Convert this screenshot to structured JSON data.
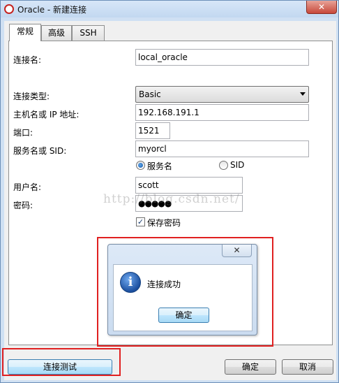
{
  "window": {
    "title": "Oracle - 新建连接",
    "close_glyph": "✕"
  },
  "tabs": [
    {
      "label": "常规"
    },
    {
      "label": "高级"
    },
    {
      "label": "SSH"
    }
  ],
  "form": {
    "connection_name": {
      "label": "连接名:",
      "value": "local_oracle"
    },
    "connection_type": {
      "label": "连接类型:",
      "value": "Basic"
    },
    "host": {
      "label": "主机名或 IP 地址:",
      "value": "192.168.191.1"
    },
    "port": {
      "label": "端口:",
      "value": "1521"
    },
    "service": {
      "label": "服务名或 SID:",
      "value": "myorcl"
    },
    "service_radio": {
      "label": "服务名",
      "selected": true
    },
    "sid_radio": {
      "label": "SID",
      "selected": false
    },
    "username": {
      "label": "用户名:",
      "value": "scott"
    },
    "password": {
      "label": "密码:",
      "value": "●●●●●"
    },
    "save_password": {
      "label": "保存密码",
      "checked": true,
      "check_glyph": "✓"
    }
  },
  "watermark": "http://blog.csdn.net/",
  "popup": {
    "close_glyph": "✕",
    "icon_glyph": "i",
    "message": "连接成功",
    "ok_label": "确定"
  },
  "footer": {
    "test_label": "连接测试",
    "ok_label": "确定",
    "cancel_label": "取消"
  },
  "colors": {
    "highlight": "#e02020",
    "focus": "#3c7fb1"
  }
}
